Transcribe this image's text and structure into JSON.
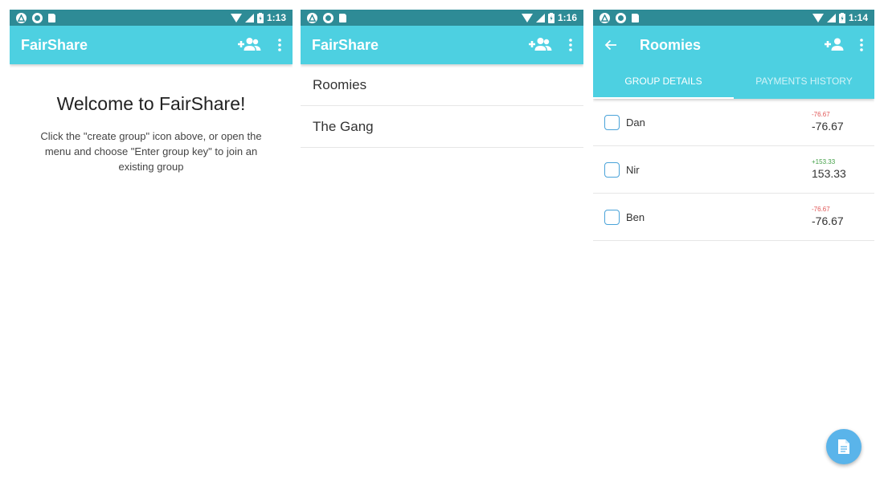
{
  "theme": {
    "primary": "#4dd0e1",
    "status_bar": "#2e8b96",
    "negative": "#e05656",
    "positive": "#43a047",
    "fab": "#5ab4ea"
  },
  "screen1": {
    "status_time": "1:13",
    "app_title": "FairShare",
    "welcome_title": "Welcome to FairShare!",
    "welcome_text": "Click the \"create group\" icon above, or open the menu and choose \"Enter group key\" to join an existing group",
    "icons": [
      "add-group-icon",
      "more-vert-icon"
    ]
  },
  "screen2": {
    "status_time": "1:16",
    "app_title": "FairShare",
    "groups": [
      {
        "label": "Roomies"
      },
      {
        "label": "The Gang"
      }
    ]
  },
  "screen3": {
    "status_time": "1:14",
    "title": "Roomies",
    "tabs": [
      {
        "label": "GROUP DETAILS",
        "active": true
      },
      {
        "label": "PAYMENTS HISTORY",
        "active": false
      }
    ],
    "members": [
      {
        "name": "Dan",
        "small_amount": "-76.67",
        "amount": "-76.67",
        "sign": "negative"
      },
      {
        "name": "Nir",
        "small_amount": "+153.33",
        "amount": "153.33",
        "sign": "positive"
      },
      {
        "name": "Ben",
        "small_amount": "-76.67",
        "amount": "-76.67",
        "sign": "negative"
      }
    ],
    "fab_icon": "document-icon"
  }
}
